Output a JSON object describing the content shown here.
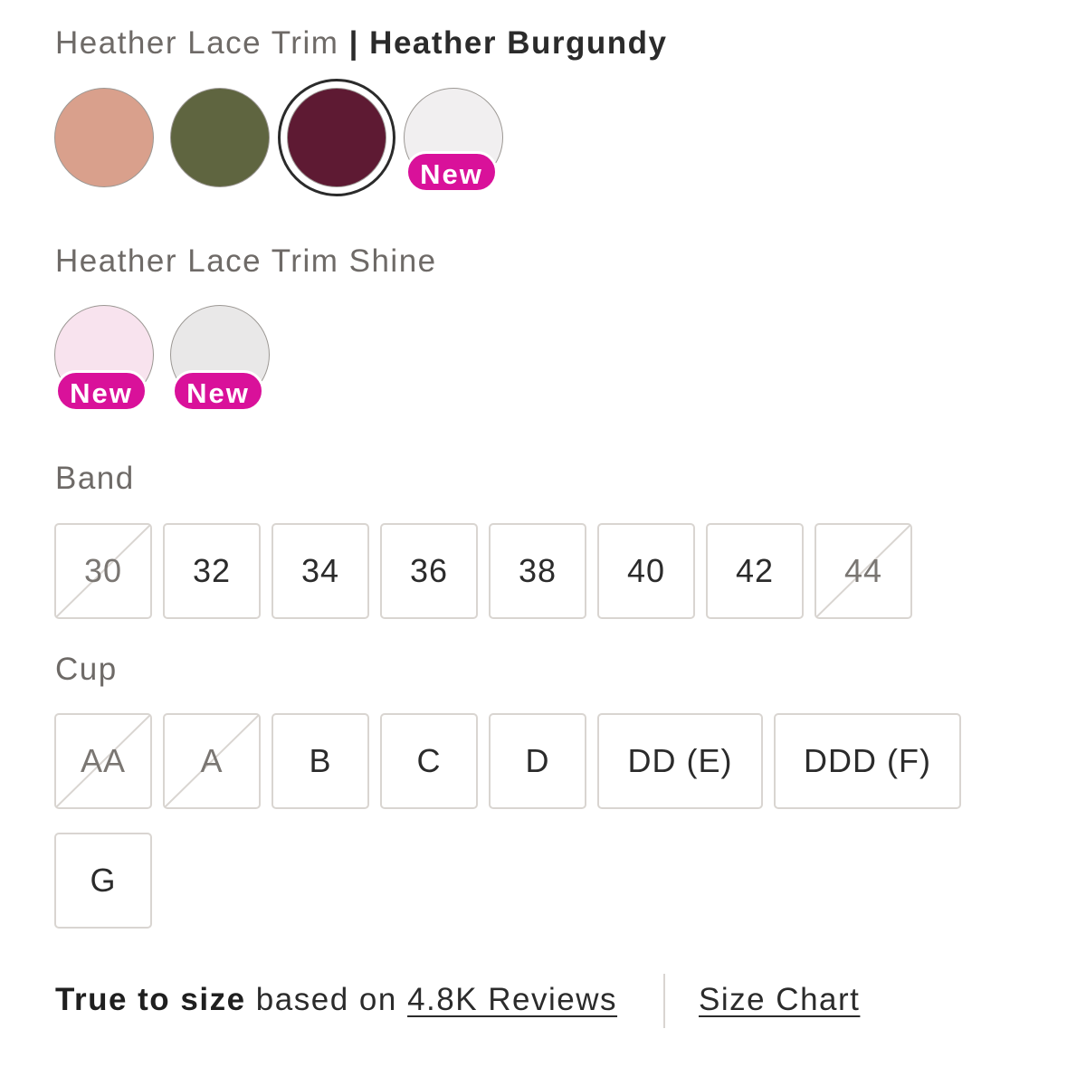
{
  "group1": {
    "label": "Heather Lace Trim",
    "separator": "|",
    "selected_name": "Heather Burgundy",
    "swatches": [
      {
        "name": "heather-blush",
        "color": "#d9a08c",
        "selected": false,
        "badge": ""
      },
      {
        "name": "heather-olive",
        "color": "#5f6540",
        "selected": false,
        "badge": ""
      },
      {
        "name": "heather-burgundy",
        "color": "#5e1a33",
        "selected": true,
        "badge": ""
      },
      {
        "name": "white-pattern",
        "color": "#f1eff0",
        "selected": false,
        "badge": "New"
      }
    ]
  },
  "group2": {
    "label": "Heather Lace Trim Shine",
    "swatches": [
      {
        "name": "pale-pink",
        "color": "#f8e3ee",
        "selected": false,
        "badge": "New"
      },
      {
        "name": "pale-grey",
        "color": "#e9e8e8",
        "selected": false,
        "badge": "New"
      }
    ]
  },
  "band": {
    "label": "Band",
    "sizes": [
      {
        "label": "30",
        "available": false
      },
      {
        "label": "32",
        "available": true
      },
      {
        "label": "34",
        "available": true
      },
      {
        "label": "36",
        "available": true
      },
      {
        "label": "38",
        "available": true
      },
      {
        "label": "40",
        "available": true
      },
      {
        "label": "42",
        "available": true
      },
      {
        "label": "44",
        "available": false
      }
    ]
  },
  "cup": {
    "label": "Cup",
    "sizes": [
      {
        "label": "AA",
        "available": false
      },
      {
        "label": "A",
        "available": false
      },
      {
        "label": "B",
        "available": true
      },
      {
        "label": "C",
        "available": true
      },
      {
        "label": "D",
        "available": true
      },
      {
        "label": "DD (E)",
        "available": true
      },
      {
        "label": "DDD (F)",
        "available": true
      },
      {
        "label": "G",
        "available": true
      }
    ]
  },
  "fit": {
    "strong": "True to size",
    "text": "based on",
    "reviews_link": "4.8K Reviews",
    "size_chart_link": "Size Chart"
  },
  "colors": {
    "badge": "#d9119a",
    "border": "#d9d5d1",
    "selected_ring": "#2b2b2b"
  }
}
